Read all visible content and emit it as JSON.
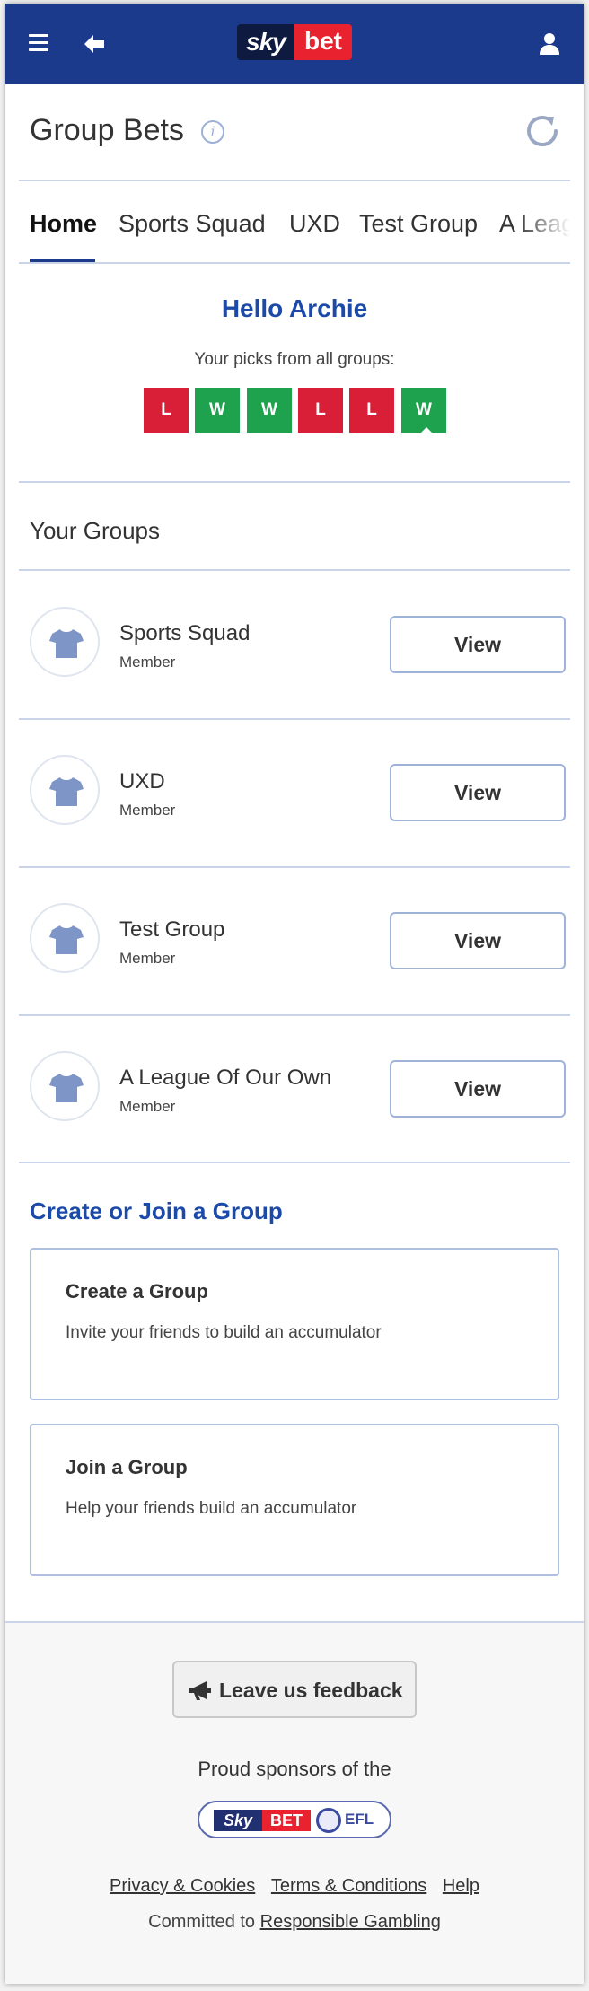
{
  "header": {
    "brand_sky": "sky",
    "brand_bet": "bet",
    "menu_icon": "hamburger-icon",
    "back_icon": "back-arrow-icon",
    "account_icon": "user-icon",
    "color": "#1c3a8c"
  },
  "page": {
    "title": "Group Bets",
    "info_icon_glyph": "i",
    "refresh_icon": "refresh-icon"
  },
  "tabs": [
    {
      "label": "Home",
      "active": true
    },
    {
      "label": "Sports Squad"
    },
    {
      "label": "UXD"
    },
    {
      "label": "Test Group"
    },
    {
      "label": "A League Of Our Own"
    }
  ],
  "greeting": {
    "hello": "Hello Archie",
    "picks_caption": "Your picks from all groups:",
    "picks": [
      "L",
      "W",
      "W",
      "L",
      "L",
      "W"
    ]
  },
  "groups": {
    "title": "Your Groups",
    "items": [
      {
        "name": "Sports Squad",
        "role": "Member",
        "action": "View"
      },
      {
        "name": "UXD",
        "role": "Member",
        "action": "View"
      },
      {
        "name": "Test Group",
        "role": "Member",
        "action": "View"
      },
      {
        "name": "A League Of Our Own",
        "role": "Member",
        "action": "View"
      }
    ]
  },
  "create_join": {
    "title": "Create or Join a Group",
    "cards": [
      {
        "title": "Create a Group",
        "desc": "Invite your friends to build an accumulator"
      },
      {
        "title": "Join a Group",
        "desc": "Help your friends build an accumulator"
      }
    ]
  },
  "footer": {
    "feedback_label": "Leave us feedback",
    "sponsors": "Proud sponsors of the",
    "efl": {
      "sky": "Sky",
      "bet": "BET",
      "efl": "EFL"
    },
    "links": [
      "Privacy & Cookies",
      "Terms & Conditions",
      "Help"
    ],
    "committed_text": "Committed to",
    "committed_link": "Responsible Gambling"
  },
  "colors": {
    "win": "#1fa24e",
    "loss": "#d91f37",
    "accent": "#1c4aa8"
  }
}
